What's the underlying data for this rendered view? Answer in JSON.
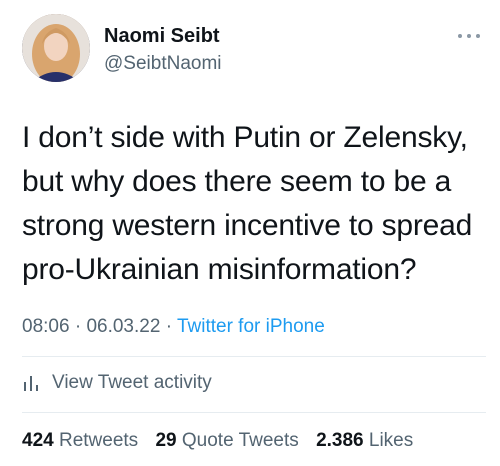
{
  "author": {
    "display_name": "Naomi Seibt",
    "handle": "@SeibtNaomi"
  },
  "tweet": {
    "text": "I don’t side with Putin or Zelensky, but why does there seem to be a strong western incentive to spread pro-Ukrainian misinformation?",
    "time": "08:06",
    "date": "06.03.22",
    "separator": "·",
    "source": "Twitter for iPhone"
  },
  "activity": {
    "label": "View Tweet activity",
    "icon": "bar-chart-icon"
  },
  "stats": {
    "retweets_count": "424",
    "retweets_label": "Retweets",
    "quotes_count": "29",
    "quotes_label": "Quote Tweets",
    "likes_count": "2.386",
    "likes_label": "Likes"
  },
  "icons": {
    "more": "more-icon",
    "avatar": "avatar"
  },
  "colors": {
    "link": "#1d9bf0",
    "secondary_text": "#536471",
    "primary_text": "#0f1419"
  }
}
